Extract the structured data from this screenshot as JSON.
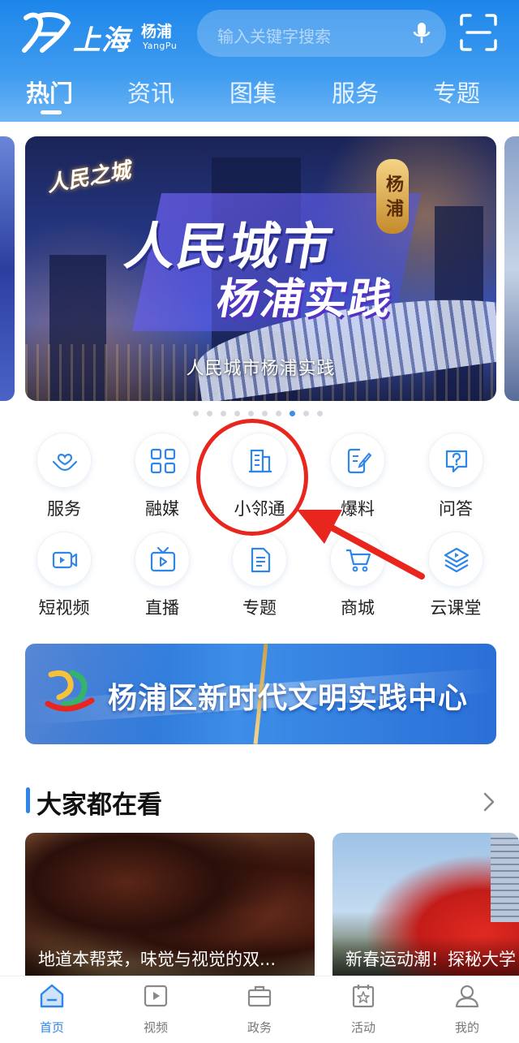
{
  "colors": {
    "accent": "#2f86ea",
    "annotation": "#e8261d"
  },
  "header": {
    "logo_city": "上海",
    "logo_district": "杨浦",
    "logo_district_en": "YangPu",
    "search_placeholder": "输入关键字搜索",
    "tabs": [
      {
        "label": "热门",
        "active": true
      },
      {
        "label": "资讯"
      },
      {
        "label": "图集"
      },
      {
        "label": "服务"
      },
      {
        "label": "专题"
      }
    ]
  },
  "banner": {
    "stamp": "人民之城",
    "badge": "杨浦",
    "headline_1": "人民城市",
    "headline_2": "杨浦实践",
    "caption": "人民城市杨浦实践",
    "carousel": {
      "count": 10,
      "active_index": 7
    }
  },
  "quick_grid": [
    {
      "label": "服务",
      "icon": "heart-hands-icon"
    },
    {
      "label": "融媒",
      "icon": "grid-icon"
    },
    {
      "label": "小邻通",
      "icon": "building-icon"
    },
    {
      "label": "爆料",
      "icon": "edit-note-icon"
    },
    {
      "label": "问答",
      "icon": "question-bubble-icon"
    },
    {
      "label": "短视频",
      "icon": "video-camera-icon"
    },
    {
      "label": "直播",
      "icon": "tv-play-icon"
    },
    {
      "label": "专题",
      "icon": "document-icon"
    },
    {
      "label": "商城",
      "icon": "cart-icon"
    },
    {
      "label": "云课堂",
      "icon": "layers-play-icon"
    }
  ],
  "civ_banner": {
    "title": "杨浦区新时代文明实践中心"
  },
  "section": {
    "title": "大家都在看",
    "cards": [
      {
        "title": "地道本帮菜，味觉与视觉的双..."
      },
      {
        "title": "新春运动潮！探秘大学"
      }
    ]
  },
  "bottom_nav": [
    {
      "label": "首页",
      "icon": "home-icon",
      "active": true
    },
    {
      "label": "视频",
      "icon": "video-icon"
    },
    {
      "label": "政务",
      "icon": "briefcase-icon"
    },
    {
      "label": "活动",
      "icon": "star-calendar-icon"
    },
    {
      "label": "我的",
      "icon": "user-icon"
    }
  ]
}
